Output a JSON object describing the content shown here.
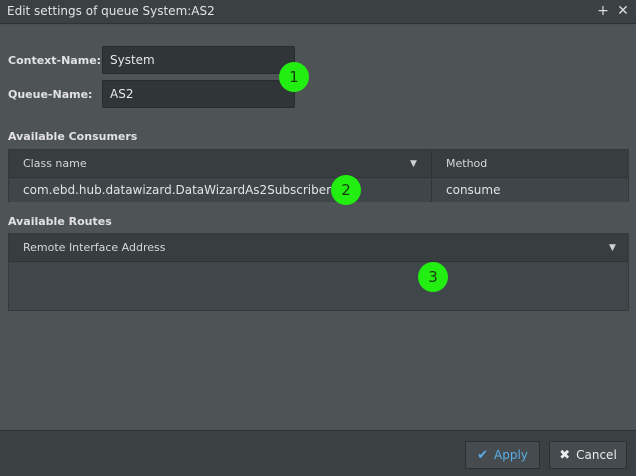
{
  "window": {
    "title": "Edit settings of queue System:AS2",
    "plus_glyph": "+",
    "close_glyph": "✕"
  },
  "form": {
    "context_label": "Context-Name:",
    "context_value": "System",
    "queue_label": "Queue-Name:",
    "queue_value": "AS2"
  },
  "consumers": {
    "title": "Available Consumers",
    "columns": [
      "Class name",
      "Method"
    ],
    "rows": [
      {
        "class_name": "com.ebd.hub.datawizard.DataWizardAs2Subscriber",
        "method": "consume"
      }
    ]
  },
  "routes": {
    "title": "Available Routes",
    "columns": [
      "Remote Interface Address"
    ],
    "rows": []
  },
  "annotations": [
    "1",
    "2",
    "3"
  ],
  "footer": {
    "apply_label": "Apply",
    "cancel_label": "Cancel"
  },
  "icons": {
    "sort_caret": "▼",
    "apply_icon": "✔",
    "cancel_icon": "✖"
  },
  "colors": {
    "annotation_badge": "#22ee11",
    "apply_text": "#5aaee8"
  }
}
